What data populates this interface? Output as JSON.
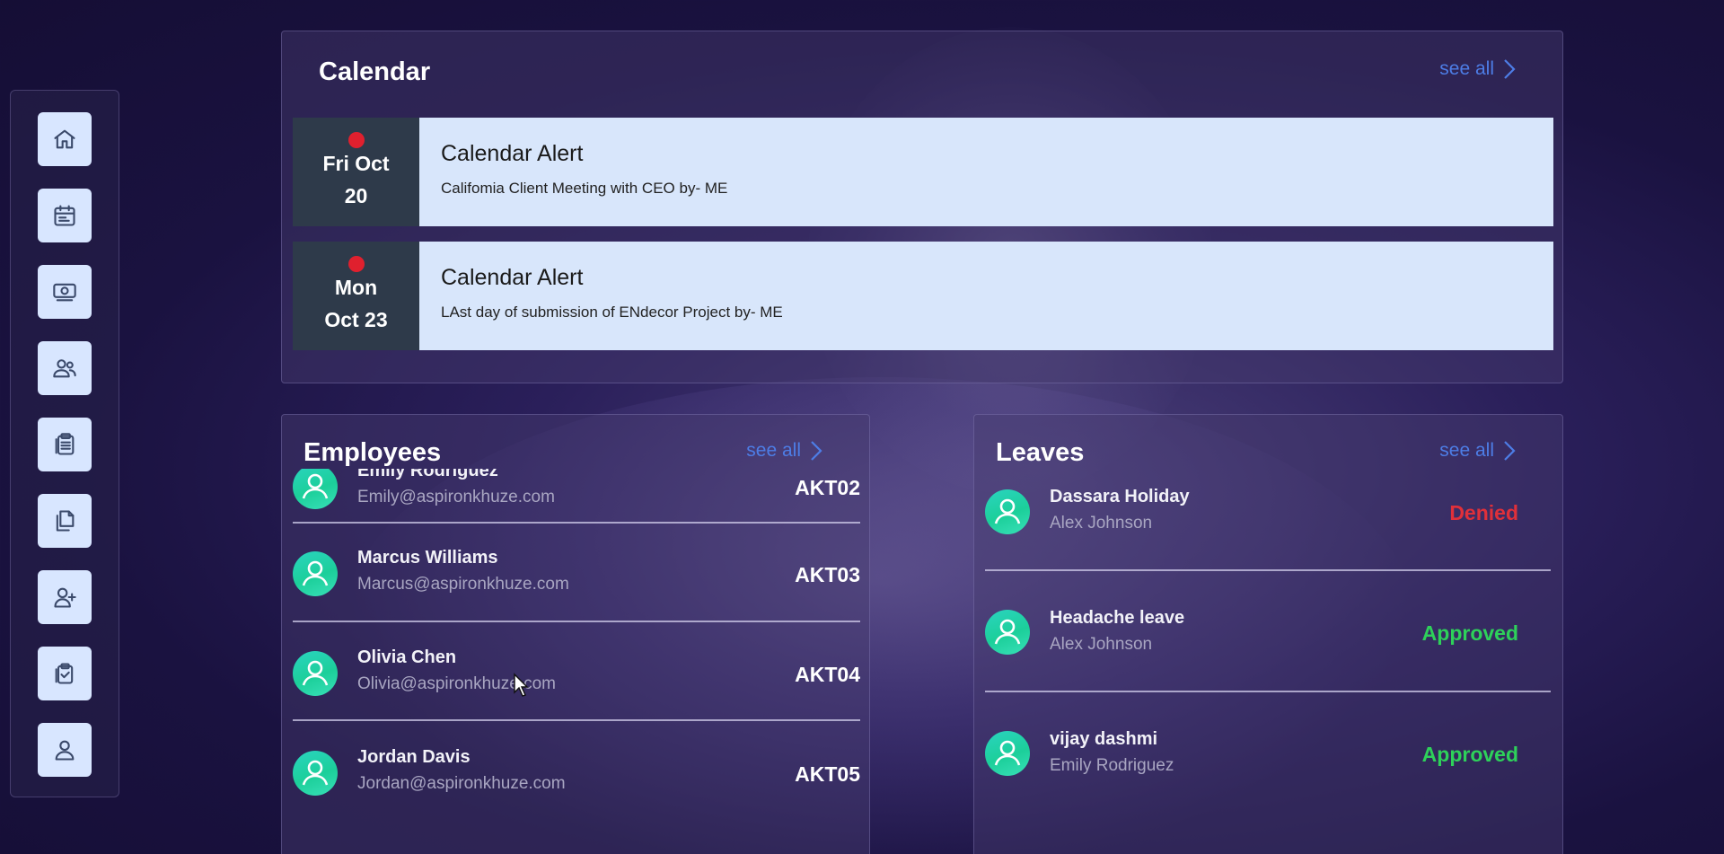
{
  "sidebar": {
    "items": [
      {
        "name": "home",
        "icon": "home-icon"
      },
      {
        "name": "calendar",
        "icon": "calendar-icon"
      },
      {
        "name": "payroll",
        "icon": "money-icon"
      },
      {
        "name": "employees",
        "icon": "users-icon"
      },
      {
        "name": "documents",
        "icon": "clipboard-list-icon"
      },
      {
        "name": "files",
        "icon": "copy-icon"
      },
      {
        "name": "add-user",
        "icon": "user-plus-icon"
      },
      {
        "name": "tasks",
        "icon": "clipboard-check-icon"
      },
      {
        "name": "profile",
        "icon": "user-icon"
      }
    ]
  },
  "calendar": {
    "title": "Calendar",
    "see_all": "see all",
    "events": [
      {
        "date_line1": "Fri Oct",
        "date_line2": "20",
        "title": "Calendar Alert",
        "description": "Califomia Client Meeting with CEO by- ME"
      },
      {
        "date_line1": "Mon",
        "date_line2": "Oct 23",
        "title": "Calendar Alert",
        "description": "LAst day of submission of ENdecor Project by- ME"
      }
    ]
  },
  "employees": {
    "title": "Employees",
    "see_all": "see all",
    "rows": [
      {
        "name": "Emily Rodriguez",
        "email": "Emily@aspironkhuze.com",
        "id": "AKT02"
      },
      {
        "name": "Marcus Williams",
        "email": "Marcus@aspironkhuze.com",
        "id": "AKT03"
      },
      {
        "name": "Olivia Chen",
        "email": "Olivia@aspironkhuze.com",
        "id": "AKT04"
      },
      {
        "name": "Jordan Davis",
        "email": "Jordan@aspironkhuze.com",
        "id": "AKT05"
      }
    ]
  },
  "leaves": {
    "title": "Leaves",
    "see_all": "see all",
    "rows": [
      {
        "title": "Dassara Holiday",
        "person": "Alex Johnson",
        "status": "Denied",
        "status_color": "#e0303a"
      },
      {
        "title": "Headache leave",
        "person": "Alex Johnson",
        "status": "Approved",
        "status_color": "#2ed15a"
      },
      {
        "title": "vijay dashmi",
        "person": "Emily Rodriguez",
        "status": "Approved",
        "status_color": "#2ed15a"
      }
    ]
  },
  "colors": {
    "accent": "#4d7de6",
    "nav_button": "#d8e6ff",
    "calendar_card": "#d8e6fb",
    "date_block": "#2e3a4a",
    "alert_dot": "#e0202e"
  }
}
